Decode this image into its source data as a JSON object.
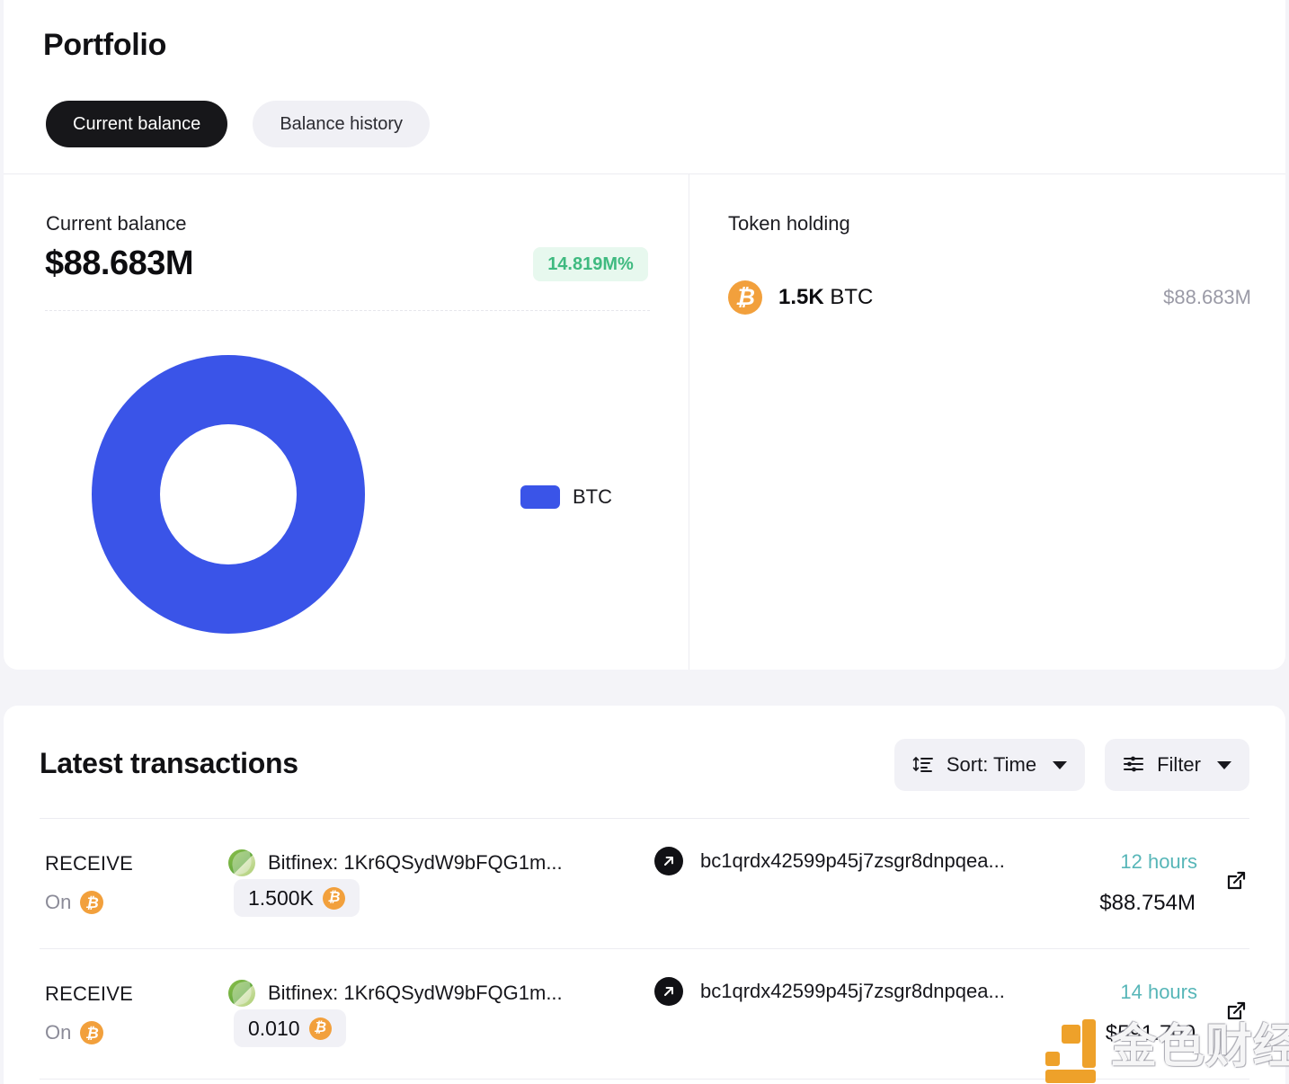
{
  "portfolio": {
    "title": "Portfolio",
    "tabs": [
      {
        "label": "Current balance",
        "active": true
      },
      {
        "label": "Balance history",
        "active": false
      }
    ],
    "balance": {
      "label": "Current balance",
      "value": "$88.683M",
      "change_badge": "14.819M%"
    },
    "legend": [
      {
        "label": "BTC",
        "color": "#3a54e8"
      }
    ],
    "token_holding": {
      "title": "Token holding",
      "rows": [
        {
          "icon": "btc-coin-icon",
          "amount": "1.5K",
          "symbol": "BTC",
          "usd": "$88.683M"
        }
      ]
    }
  },
  "transactions": {
    "title": "Latest transactions",
    "sort_button": {
      "label": "Sort: Time",
      "icon": "sort-icon"
    },
    "filter_button": {
      "label": "Filter",
      "icon": "filter-icon"
    },
    "rows": [
      {
        "type": "RECEIVE",
        "on_label": "On",
        "chain_icon": "btc-coin-icon",
        "from_icon": "bitfinex-leaf-icon",
        "from": "Bitfinex: 1Kr6QSydW9bFQG1m...",
        "direction_icon": "arrow-up-right-icon",
        "to": "bc1qrdx42599p45j7zsgr8dnpqea...",
        "amount": "1.500K",
        "amount_icon": "btc-coin-icon",
        "time": "12 hours",
        "usd": "$88.754M",
        "link_icon": "external-link-icon"
      },
      {
        "type": "RECEIVE",
        "on_label": "On",
        "chain_icon": "btc-coin-icon",
        "from_icon": "bitfinex-leaf-icon",
        "from": "Bitfinex: 1Kr6QSydW9bFQG1m...",
        "direction_icon": "arrow-up-right-icon",
        "to": "bc1qrdx42599p45j7zsgr8dnpqea...",
        "amount": "0.010",
        "amount_icon": "btc-coin-icon",
        "time": "14 hours",
        "usd": "$591.700",
        "link_icon": "external-link-icon"
      }
    ]
  },
  "watermark": {
    "text": "金色财经"
  },
  "chart_data": {
    "type": "pie",
    "title": "Current balance",
    "categories": [
      "BTC"
    ],
    "values": [
      88.683
    ],
    "percentages": [
      100
    ],
    "colors": [
      "#3a54e8"
    ],
    "legend_position": "right",
    "donut": true,
    "unit": "USD millions"
  },
  "colors": {
    "accent": "#3a54e8",
    "positive": "#3fba80",
    "positive_bg": "#e7f8ee",
    "btc_orange": "#f2a03c",
    "time_teal": "#57b6b8",
    "page_bg": "#f4f4f8",
    "card_bg": "#ffffff",
    "chip_bg": "#f1f1f6",
    "tab_active_bg": "#17171a"
  }
}
